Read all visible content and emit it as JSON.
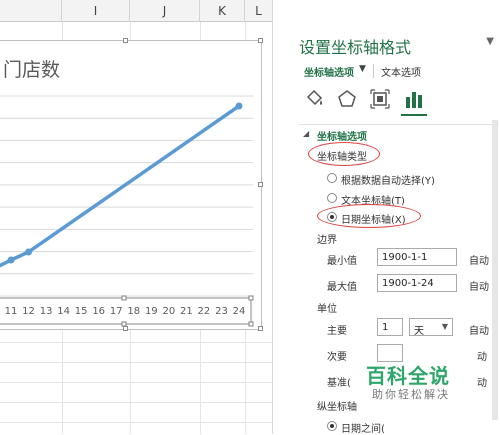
{
  "sheet": {
    "columns": [
      "I",
      "J",
      "K",
      "L"
    ]
  },
  "chart": {
    "title": "门店数",
    "x_tick_labels": [
      "11",
      "12",
      "13",
      "14",
      "15",
      "16",
      "17",
      "18",
      "19",
      "20",
      "21",
      "22",
      "23",
      "24"
    ],
    "line_color": "#5b9bd5"
  },
  "chart_data": {
    "type": "line",
    "title": "门店数",
    "xlabel": "",
    "ylabel": "",
    "categories": [
      "11",
      "12",
      "13",
      "14",
      "15",
      "16",
      "17",
      "18",
      "19",
      "20",
      "21",
      "22",
      "23",
      "24"
    ],
    "points": [
      {
        "x": "11",
        "y": 0.18
      },
      {
        "x": "12",
        "y": 0.22
      },
      {
        "x": "24",
        "y": 0.95
      }
    ],
    "grid": true
  },
  "panel": {
    "title": "设置坐标轴格式",
    "menu_icon": "dropdown-arrow",
    "tab_axis_options": "坐标轴选项",
    "tab_text_options": "文本选项",
    "icons": [
      "fill-bucket-icon",
      "pentagon-icon",
      "size-properties-icon",
      "bar-chart-icon"
    ],
    "section_axis_options": "坐标轴选项",
    "axis_type_label": "坐标轴类型",
    "radio_auto": "根据数据自动选择(Y)",
    "radio_text": "文本坐标轴(T)",
    "radio_date": "日期坐标轴(X)",
    "bounds_label": "边界",
    "min_label": "最小值",
    "min_value": "1900-1-1",
    "min_auto": "自动",
    "max_label": "最大值",
    "max_value": "1900-1-24",
    "max_auto": "自动",
    "units_label": "单位",
    "major_label": "主要",
    "major_value": "1",
    "major_unit": "天",
    "major_auto": "自动",
    "minor_label": "次要",
    "minor_auto": "动",
    "base_label": "基准(",
    "base_auto": "动",
    "vertical_cross_label": "纵坐标轴",
    "between_dates": "日期之间(",
    "highlight_color": "#e0433e",
    "accent": "#217346"
  },
  "watermark": {
    "brand": "百科全说",
    "slogan": "助你轻松解决"
  }
}
